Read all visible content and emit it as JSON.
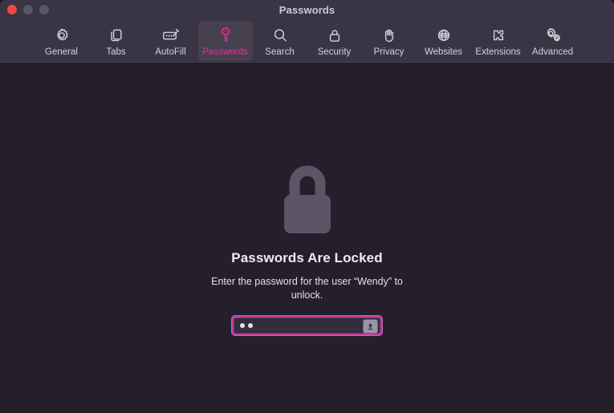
{
  "window": {
    "title": "Passwords",
    "traffic_lights": [
      {
        "name": "close",
        "color": "#f0493e"
      },
      {
        "name": "minimize",
        "color": "#5b5667"
      },
      {
        "name": "zoom",
        "color": "#5b5667"
      }
    ]
  },
  "toolbar": {
    "selected": "Passwords",
    "accent_color": "#f12ba0",
    "items": [
      {
        "label": "General",
        "icon": "gear-icon"
      },
      {
        "label": "Tabs",
        "icon": "tabs-icon"
      },
      {
        "label": "AutoFill",
        "icon": "autofill-icon"
      },
      {
        "label": "Passwords",
        "icon": "key-icon"
      },
      {
        "label": "Search",
        "icon": "magnifier-icon"
      },
      {
        "label": "Security",
        "icon": "padlock-icon"
      },
      {
        "label": "Privacy",
        "icon": "hand-icon"
      },
      {
        "label": "Websites",
        "icon": "globe-icon"
      },
      {
        "label": "Extensions",
        "icon": "puzzle-icon"
      },
      {
        "label": "Advanced",
        "icon": "gears-icon"
      }
    ]
  },
  "main": {
    "lock_icon": "large-padlock-icon",
    "heading": "Passwords Are Locked",
    "subtext": "Enter the password for the user “Wendy” to unlock.",
    "password_field": {
      "value": "••",
      "masked_character_count": 2,
      "placeholder": "",
      "focused": true,
      "focus_ring_color": "#c13ba0",
      "accessory_button_icon": "key-autofill-icon"
    }
  }
}
